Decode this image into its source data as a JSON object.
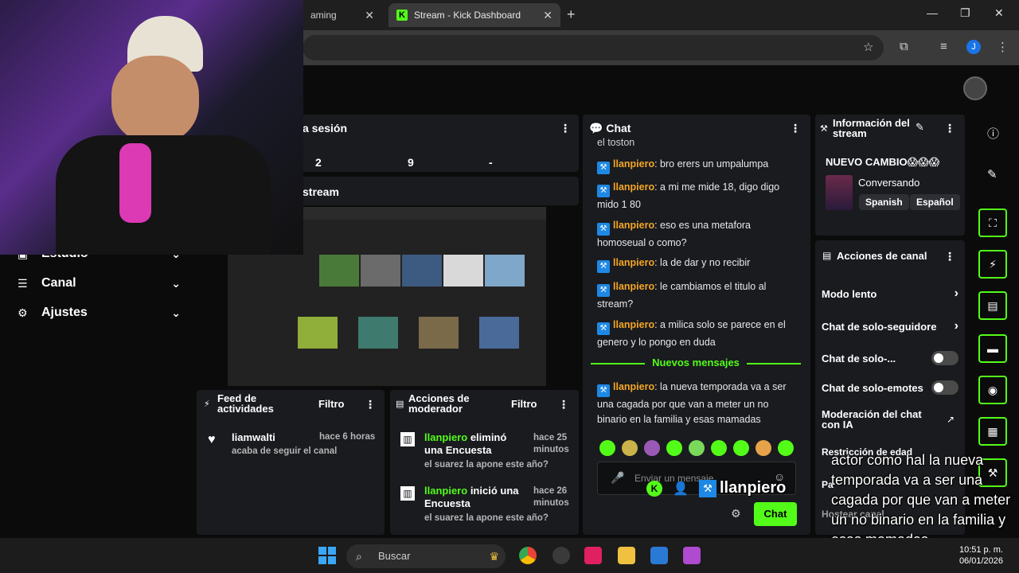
{
  "browser": {
    "tabs": [
      {
        "title": "aming"
      },
      {
        "title": "Stream - Kick Dashboard"
      }
    ],
    "profile_initial": "J"
  },
  "sidebar": {
    "items": [
      {
        "label": "Estudio"
      },
      {
        "label": "Canal"
      },
      {
        "label": "Ajustes"
      }
    ]
  },
  "session": {
    "title": "a sesión",
    "stats": [
      "2",
      "9",
      "-"
    ],
    "stream_label": "stream"
  },
  "chat": {
    "title": "Chat",
    "partial_top": "el toston",
    "messages": [
      {
        "user": "llanpiero",
        "text": "bro erers un umpalumpa"
      },
      {
        "user": "llanpiero",
        "text": "a mi me mide 18, digo digo mido 1 80"
      },
      {
        "user": "llanpiero",
        "text": "eso es una metafora homoseual o como?"
      },
      {
        "user": "llanpiero",
        "text": "la de dar y no recibir"
      },
      {
        "user": "llanpiero",
        "text": "le cambiamos el titulo al stream?"
      },
      {
        "user": "llanpiero",
        "text": "a milica solo se parece en el genero y lo pongo en duda"
      },
      {
        "user": "llanpiero",
        "text": "la nueva temporada va a ser una cagada por que van a meter un no binario en la familia y esas mamadas"
      }
    ],
    "new_messages_label": "Nuevos mensajes",
    "input_placeholder": "Enviar un mensaje",
    "send_label": "Chat"
  },
  "stream_info": {
    "title": "Información del stream",
    "stream_title": "NUEVO CAMBIO😱😱😱",
    "category": "Conversando",
    "tags": [
      "Spanish",
      "Español"
    ]
  },
  "channel_actions": {
    "title": "Acciones de canal",
    "items": [
      {
        "label": "Modo lento",
        "control": "chevron"
      },
      {
        "label": "Chat de solo-seguidore",
        "control": "chevron"
      },
      {
        "label": "Chat de solo-...",
        "control": "toggle"
      },
      {
        "label": "Chat de solo-emotes",
        "control": "toggle"
      },
      {
        "label": "Moderación del chat con IA",
        "control": "external"
      },
      {
        "label": "Restricción de edad",
        "control": "chevron"
      },
      {
        "label": "Pa",
        "control": "chevron"
      },
      {
        "label": "Hostear canal",
        "control": "none"
      }
    ]
  },
  "activity_feed": {
    "title": "Feed de actividades",
    "filter_label": "Filtro",
    "items": [
      {
        "user": "liamwalti",
        "time": "hace 6 horas",
        "detail": "acaba de seguir el canal"
      }
    ]
  },
  "mod_actions": {
    "title": "Acciones de moderador",
    "filter_label": "Filtro",
    "items": [
      {
        "user": "llanpiero",
        "action": "eliminó una Encuesta",
        "time_line1": "hace 25",
        "time_line2": "minutos",
        "detail": "el suarez la apone este año?"
      },
      {
        "user": "llanpiero",
        "action": "inició una Encuesta",
        "time_line1": "hace 26",
        "time_line2": "minutos",
        "detail": "el suarez la apone este año?"
      }
    ]
  },
  "overlay": {
    "username": "llanpiero",
    "subtitle": "actor como hal la nueva temporada va a ser una cagada por que van a meter un no binario en la familia y esas mamadas"
  },
  "taskbar": {
    "search_label": "Buscar",
    "time": "10:51 p. m.",
    "date": "06/01/2026"
  },
  "colors": {
    "kick_green": "#53fc18",
    "username": "#f5a623",
    "panel": "#191b1f"
  }
}
